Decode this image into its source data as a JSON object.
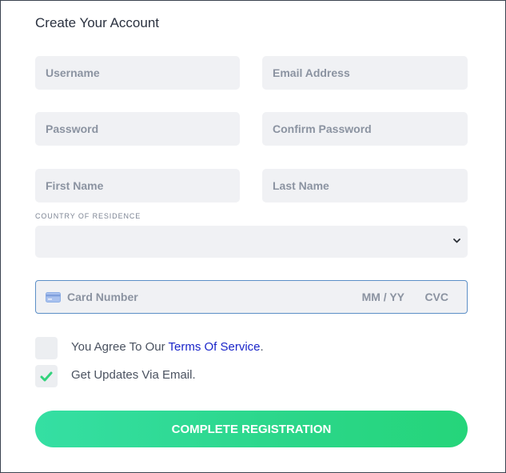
{
  "form": {
    "title": "Create Your Account",
    "fields": {
      "username_placeholder": "Username",
      "email_placeholder": "Email Address",
      "password_placeholder": "Password",
      "confirm_password_placeholder": "Confirm Password",
      "first_name_placeholder": "First Name",
      "last_name_placeholder": "Last Name"
    },
    "country": {
      "label": "COUNTRY OF RESIDENCE",
      "selected": ""
    },
    "card": {
      "number_placeholder": "Card Number",
      "expiry_placeholder": "MM / YY",
      "cvc_placeholder": "CVC",
      "icon": "credit-card-icon"
    },
    "checkboxes": {
      "terms_prefix": "You Agree To Our ",
      "terms_link": "Terms Of Service",
      "terms_suffix": ".",
      "terms_checked": false,
      "updates_label": "Get Updates Via Email.",
      "updates_checked": true
    },
    "submit_label": "COMPLETE REGISTRATION"
  },
  "colors": {
    "accent_start": "#35dfa3",
    "accent_end": "#25d57a",
    "link": "#1a25c9",
    "check": "#33d27c",
    "field_bg": "#f0f1f4",
    "focus_border": "#5c8fc7"
  }
}
